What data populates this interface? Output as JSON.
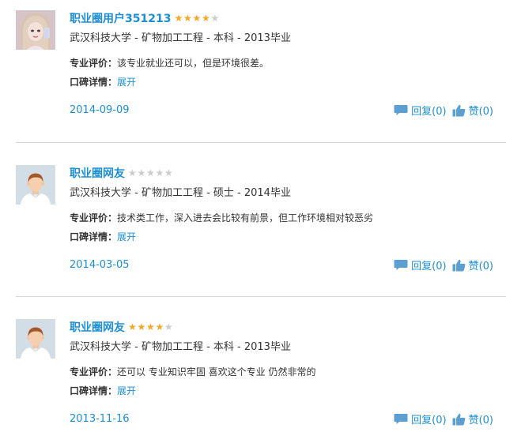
{
  "reviews": [
    {
      "username": "职业圈用户351213",
      "rating": 4,
      "school_line": "武汉科技大学 - 矿物加工工程 - 本科 - 2013毕业",
      "eval_label": "专业评价：",
      "eval_text": "该专业就业还可以，但是环境很差。",
      "detail_label": "口碑详情：",
      "expand_label": "展开",
      "date": "2014-09-09",
      "reply_label": "回复(0)",
      "like_label": "赞(0)",
      "avatar": "photo-avatar"
    },
    {
      "username": "职业圈网友",
      "rating": 0,
      "school_line": "武汉科技大学 - 矿物加工工程 - 硕士 - 2014毕业",
      "eval_label": "专业评价：",
      "eval_text": "技术类工作，深入进去会比较有前景，但工作环境相对较恶劣",
      "detail_label": "口碑详情：",
      "expand_label": "展开",
      "date": "2014-03-05",
      "reply_label": "回复(0)",
      "like_label": "赞(0)",
      "avatar": "default-avatar"
    },
    {
      "username": "职业圈网友",
      "rating": 4,
      "school_line": "武汉科技大学 - 矿物加工工程 - 本科 - 2013毕业",
      "eval_label": "专业评价：",
      "eval_text": "还可以 专业知识牢固 喜欢这个专业 仍然非常的",
      "detail_label": "口碑详情：",
      "expand_label": "展开",
      "date": "2013-11-16",
      "reply_label": "回复(0)",
      "like_label": "赞(0)",
      "avatar": "default-avatar"
    }
  ],
  "rating_max": 5,
  "colors": {
    "link": "#1b8fd6",
    "star_on": "#f5a623",
    "star_off": "#cccccc",
    "icon": "#5b9fd3",
    "divider": "#d8d8d8"
  }
}
